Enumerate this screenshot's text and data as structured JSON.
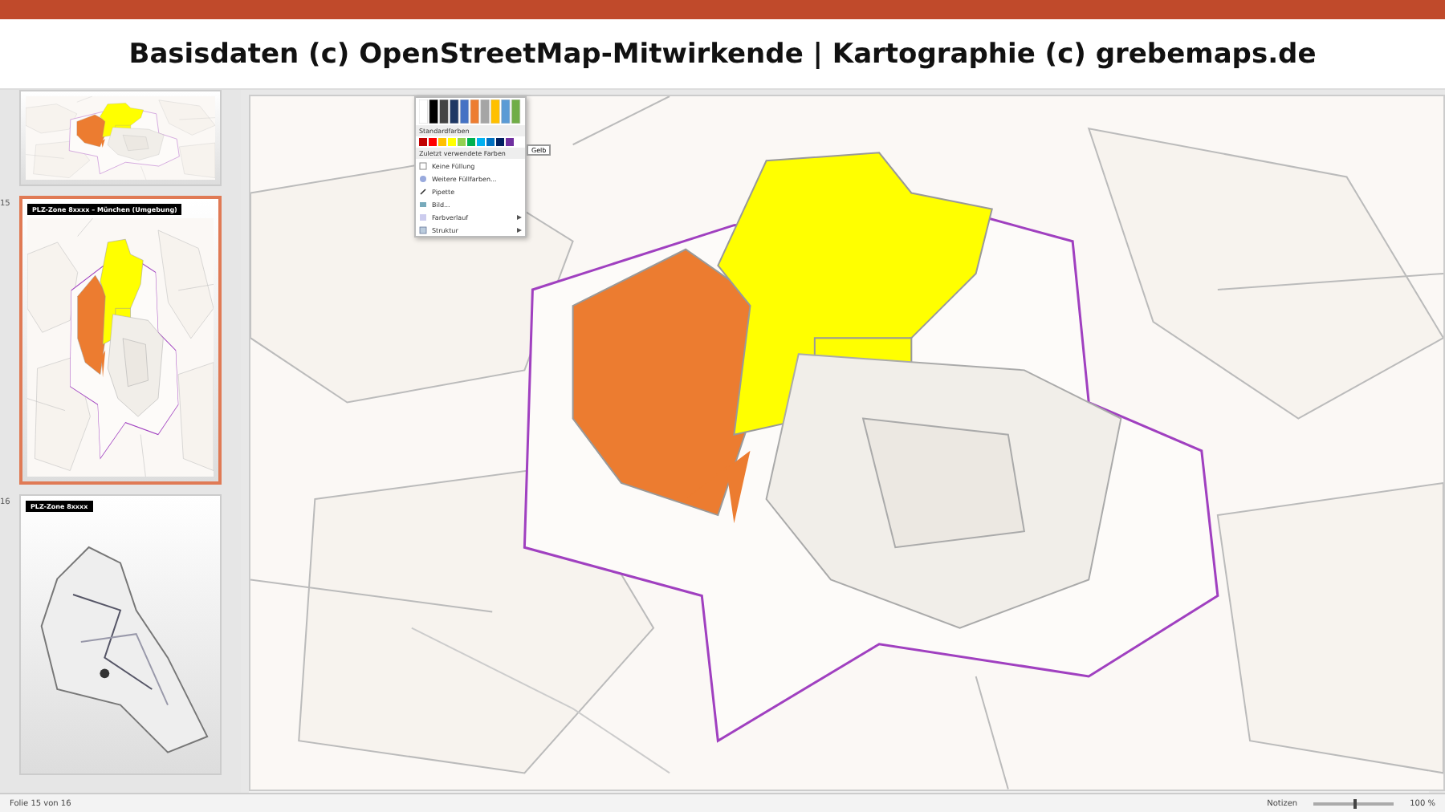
{
  "banner": {
    "text": "Basisdaten (c) OpenStreetMap-Mitwirkende | Kartographie (c) grebemaps.de"
  },
  "slides": [
    {
      "kind": "partial",
      "selected": false
    },
    {
      "number": "15",
      "title": "PLZ-Zone 8xxxx – München (Umgebung)",
      "kind": "region",
      "selected": true
    },
    {
      "number": "16",
      "title": "PLZ-Zone 8xxxx",
      "kind": "full",
      "selected": false
    }
  ],
  "fill_menu": {
    "theme_heading": "Standardfarben",
    "recent_heading": "Zuletzt verwendete Farben",
    "tooltip": "Gelb",
    "items": [
      {
        "label": "Keine Füllung",
        "submenu": false
      },
      {
        "label": "Weitere Füllfarben...",
        "submenu": false
      },
      {
        "label": "Pipette",
        "submenu": false
      },
      {
        "label": "Bild...",
        "submenu": false
      },
      {
        "label": "Farbverlauf",
        "submenu": true
      },
      {
        "label": "Struktur",
        "submenu": true
      }
    ]
  },
  "status_bar": {
    "slide_info": "Folie 15 von 16",
    "notes": "Notizen",
    "zoom": "100 %",
    "level": 0.5
  }
}
